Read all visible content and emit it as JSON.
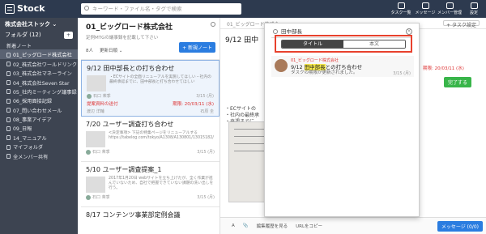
{
  "app": {
    "logo": "Stock"
  },
  "top_search": {
    "placeholder": "キーワード・ファイル名・タグで検索"
  },
  "top_nav": [
    {
      "label": "タスク一覧"
    },
    {
      "label": "メッセージ"
    },
    {
      "label": "メンバー管理"
    },
    {
      "label": "設定"
    }
  ],
  "sidebar": {
    "company": "株式会社ストック ⌄",
    "folder_label": "フォルダ",
    "folder_count": "(12)",
    "add_label": "+",
    "section": "新着ノート",
    "items": [
      {
        "label": "01_ピッグロード株式会社"
      },
      {
        "label": "02_株式会社ワールドリンク"
      },
      {
        "label": "03_株式会社マネーライン"
      },
      {
        "label": "04_株式会社Seven Star"
      },
      {
        "label": "05_社内ミーティング議事録"
      },
      {
        "label": "06_採用面接記録"
      },
      {
        "label": "07_問い合わせメール"
      },
      {
        "label": "08_事業アイデア"
      },
      {
        "label": "09_日報"
      },
      {
        "label": "14_マニュアル"
      },
      {
        "label": "マイフォルダ"
      },
      {
        "label": "全メンバー共有"
      }
    ]
  },
  "list": {
    "title": "01_ビッグロード株式会社",
    "description": "定例MTGの議事録を記載して下さい",
    "members": "8人",
    "sort": "更新日順 ⌄",
    "new_button": "+ 新規ノート",
    "notes": [
      {
        "date": "9/12",
        "title": "田中部長との打ち合わせ",
        "text": "・ECサイトの全面リニューアルを実施してほしい・社内の最終承認までに、田中部長と打ち合わせてほしい",
        "author": "石口 茉季",
        "updated": "3/15 (月)",
        "task_label": "提案資料の送付",
        "due": "期限: 20/03/11 (水)",
        "assignee_a": "渡辺 洋輔",
        "assignee_b": "石原 圭"
      },
      {
        "date": "7/20",
        "title": "ユーザー調査打ち合わせ",
        "text": "<決定事項> 下記の特集ページをリニューアルする https://tabelog.com/tokyo/A1308/A130801/13015182/",
        "author": "石口 茉季",
        "updated": "3/15 (月)"
      },
      {
        "date": "5/10",
        "title": "ユーザー調査提案_1",
        "text": "2017年1月20日 webサイトを立ち上げたが、全く作業が進んでいないため、自社で把握できていない課題の洗い出しを行う。",
        "author": "石口 茉季",
        "updated": "3/15 (月)"
      },
      {
        "date": "8/17",
        "title": "コンテンツ事業部定例会議",
        "text": "",
        "author": "",
        "updated": ""
      }
    ]
  },
  "detail": {
    "breadcrumb": "01_ビッグロード株式会",
    "task_settings": "+ タスク設定",
    "title": "9/12 田中",
    "body_lines": [
      "・ECサイトの",
      "・社内の最終承",
      "・来週までに"
    ],
    "overlay_due": "期限: 20/03/11 (水)",
    "done_button": "完了する",
    "bottom_history": "編集履歴を見る",
    "bottom_copy": "URLをコピー",
    "message_button": "メッセージ (0/0)"
  },
  "popup": {
    "search_value": "田中部長",
    "close": "×",
    "tab_title": "タイトル",
    "tab_body": "本文",
    "result": {
      "folder": "01_ビッグロード株式会社",
      "title_prefix": "9/12 ",
      "title_highlight": "田中部長",
      "title_suffix": "との打ち合わせ",
      "subtitle": "タスクの期限が更新されました。",
      "date": "3/15 (月)"
    }
  },
  "colors": {
    "topbar": "#2d3a4f",
    "sidebar": "#3d4451",
    "accent": "#2b7de0",
    "highlight_outline": "#e8412d",
    "done": "#39b54a"
  }
}
